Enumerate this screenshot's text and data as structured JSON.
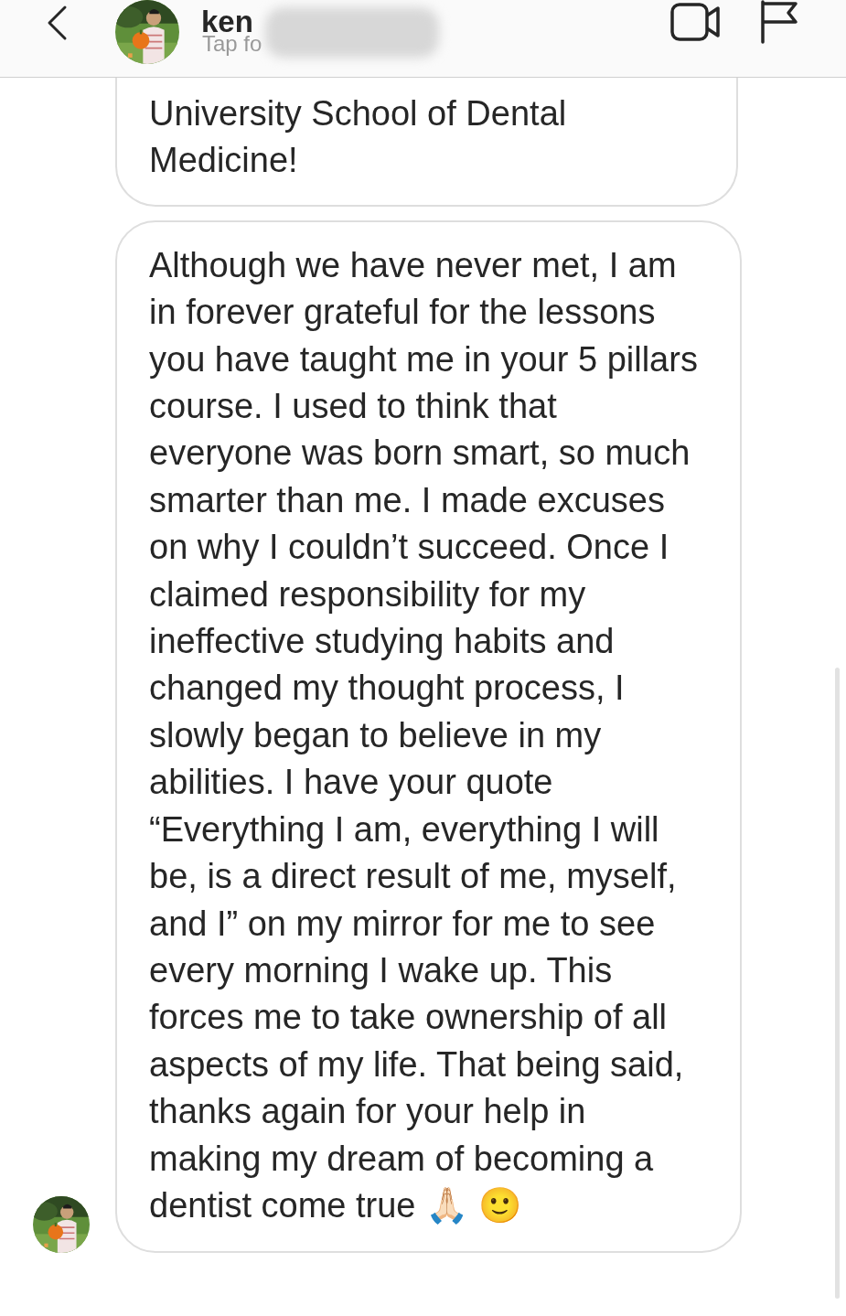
{
  "header": {
    "name": "ken",
    "subtitle": "Tap fo"
  },
  "messages": [
    {
      "text": "University School of Dental Medicine!",
      "avatar": false
    },
    {
      "text": "Although we have never met, I am in forever grateful for the lessons you have taught me in your 5 pillars course. I used to think that everyone was born smart, so much smarter than me. I made excuses on why I couldn’t succeed. Once I claimed responsibility for my ineffective studying habits and  changed my thought process, I slowly began to believe in my abilities. I have your quote “Everything I am, everything I will be, is a direct result of me, myself, and I” on my mirror for me to see every morning I wake up. This forces me to take ownership of all aspects of my life. That being said, thanks again for your help in making my dream of becoming a dentist come true 🙏🏻 🙂",
      "avatar": true
    }
  ]
}
